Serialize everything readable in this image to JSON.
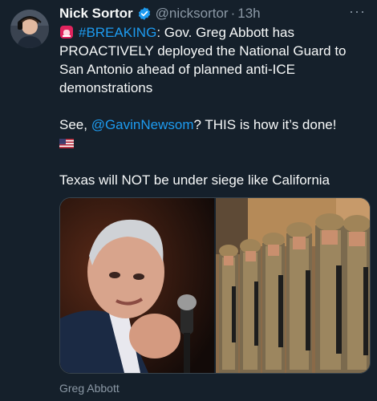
{
  "author": {
    "name": "Nick Sortor",
    "handle": "@nicksortor",
    "time": "13h",
    "verified_color": "#1d9bf0"
  },
  "menu": {
    "more_icon": "more-dots-icon",
    "label": "···"
  },
  "tweet": {
    "siren_icon": "police-light-emoji",
    "hashtag": "#BREAKING",
    "line1_rest": ": Gov. Greg Abbott has PROACTIVELY deployed the National Guard to San Antonio ahead of planned anti-ICE demonstrations",
    "line2_pre": "See, ",
    "mention": "@GavinNewsom",
    "line2_post": "? THIS is how it’s done!",
    "flag_icon": "us-flag-emoji",
    "line3": "Texas will NOT be under siege like California"
  },
  "media": {
    "left_image": "greg-abbott-speaking-at-microphone",
    "right_image": "national-guard-soldiers-in-formation",
    "caption": "Greg Abbott"
  },
  "colors": {
    "background": "#15202b",
    "text": "#f7f9f9",
    "secondary": "#8b98a5",
    "link": "#1d9bf0"
  }
}
